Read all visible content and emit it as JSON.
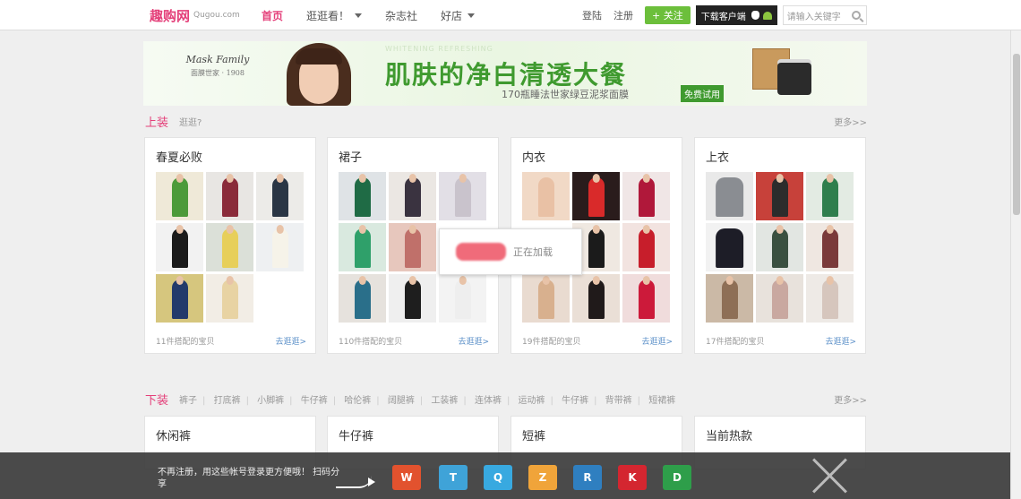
{
  "header": {
    "logo_text": "趣购网",
    "logo_domain": "Qugou.com",
    "nav": [
      "首页",
      "逛逛看！",
      "杂志社",
      "好店"
    ],
    "login": "登陆",
    "register": "注册",
    "follow_label": "+ 关注",
    "app_label": "下载客户端",
    "search_placeholder": "请输入关键字"
  },
  "banner": {
    "brand": "Mask Family",
    "brand_sub": "面膜世家 · 1908",
    "ghost_text": "WHITENING REFRESHING",
    "headline": "肌肤的净白清透大餐",
    "subline": "170瓶睡法世家绿豆泥浆面膜",
    "badge": "免费试用"
  },
  "sections": [
    {
      "title": "上装",
      "subtitle": "逛逛?",
      "tags": [],
      "more": "更多>>",
      "cards": [
        {
          "title": "春夏必败",
          "count": "11件搭配的宝贝",
          "link": "去逛逛>"
        },
        {
          "title": "裙子",
          "count": "110件搭配的宝贝",
          "link": "去逛逛>"
        },
        {
          "title": "内衣",
          "count": "19件搭配的宝贝",
          "link": "去逛逛>"
        },
        {
          "title": "上衣",
          "count": "17件搭配的宝贝",
          "link": "去逛逛>"
        }
      ]
    },
    {
      "title": "下装",
      "subtitle": "",
      "tags": [
        "裤子",
        "打底裤",
        "小脚裤",
        "牛仔裤",
        "哈伦裤",
        "阔腿裤",
        "工装裤",
        "连体裤",
        "运动裤",
        "牛仔裤",
        "背带裤",
        "短裙裤"
      ],
      "more": "更多>>",
      "cards": [
        {
          "title": "休闲裤"
        },
        {
          "title": "牛仔裤"
        },
        {
          "title": "短裤"
        },
        {
          "title": "当前热款"
        }
      ]
    }
  ],
  "popup": {
    "text": "正在加载"
  },
  "share_bar": {
    "text": "不再注册，用这些帐号登录更方便哦！ 扫码分享"
  },
  "colors": {
    "accent": "#e4407a",
    "banner_green": "#3f9a2f",
    "follow_green": "#6cbf3b"
  },
  "icons": [
    "search-icon",
    "apple-icon",
    "android-icon",
    "weibo-icon",
    "tencent-weibo-icon",
    "qq-icon",
    "qzone-icon",
    "renren-icon",
    "kaixin-icon",
    "douban-icon",
    "close-icon"
  ]
}
